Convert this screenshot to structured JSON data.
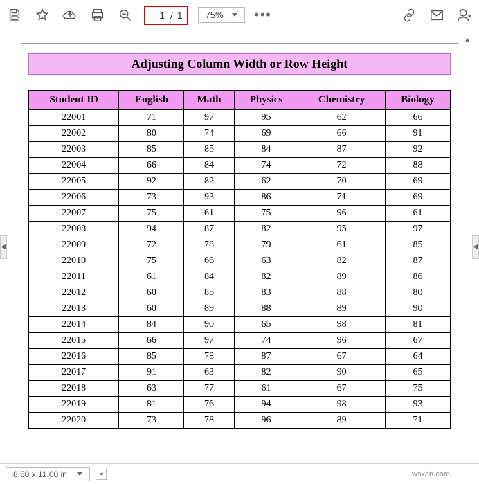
{
  "toolbar": {
    "page_current": "1",
    "page_sep": "/",
    "page_total": "1",
    "zoom": "75%"
  },
  "document": {
    "title": "Adjusting Column Width or Row Height",
    "headers": [
      "Student ID",
      "English",
      "Math",
      "Physics",
      "Chemistry",
      "Biology"
    ],
    "rows": [
      [
        "22001",
        "71",
        "97",
        "95",
        "62",
        "66"
      ],
      [
        "22002",
        "80",
        "74",
        "69",
        "66",
        "91"
      ],
      [
        "22003",
        "85",
        "85",
        "84",
        "87",
        "92"
      ],
      [
        "22004",
        "66",
        "84",
        "74",
        "72",
        "88"
      ],
      [
        "22005",
        "92",
        "82",
        "62",
        "70",
        "69"
      ],
      [
        "22006",
        "73",
        "93",
        "86",
        "71",
        "69"
      ],
      [
        "22007",
        "75",
        "61",
        "75",
        "96",
        "61"
      ],
      [
        "22008",
        "94",
        "87",
        "82",
        "95",
        "97"
      ],
      [
        "22009",
        "72",
        "78",
        "79",
        "61",
        "85"
      ],
      [
        "22010",
        "75",
        "66",
        "63",
        "82",
        "87"
      ],
      [
        "22011",
        "61",
        "84",
        "82",
        "89",
        "86"
      ],
      [
        "22012",
        "60",
        "85",
        "83",
        "88",
        "80"
      ],
      [
        "22013",
        "60",
        "89",
        "88",
        "89",
        "90"
      ],
      [
        "22014",
        "84",
        "90",
        "65",
        "98",
        "81"
      ],
      [
        "22015",
        "66",
        "97",
        "74",
        "96",
        "67"
      ],
      [
        "22016",
        "85",
        "78",
        "87",
        "67",
        "64"
      ],
      [
        "22017",
        "91",
        "63",
        "82",
        "90",
        "65"
      ],
      [
        "22018",
        "63",
        "77",
        "61",
        "67",
        "75"
      ],
      [
        "22019",
        "81",
        "76",
        "94",
        "98",
        "93"
      ],
      [
        "22020",
        "73",
        "78",
        "96",
        "89",
        "71"
      ]
    ]
  },
  "status": {
    "dimensions": "8.50 x 11.00 in"
  },
  "watermark": "wsxdn.com"
}
